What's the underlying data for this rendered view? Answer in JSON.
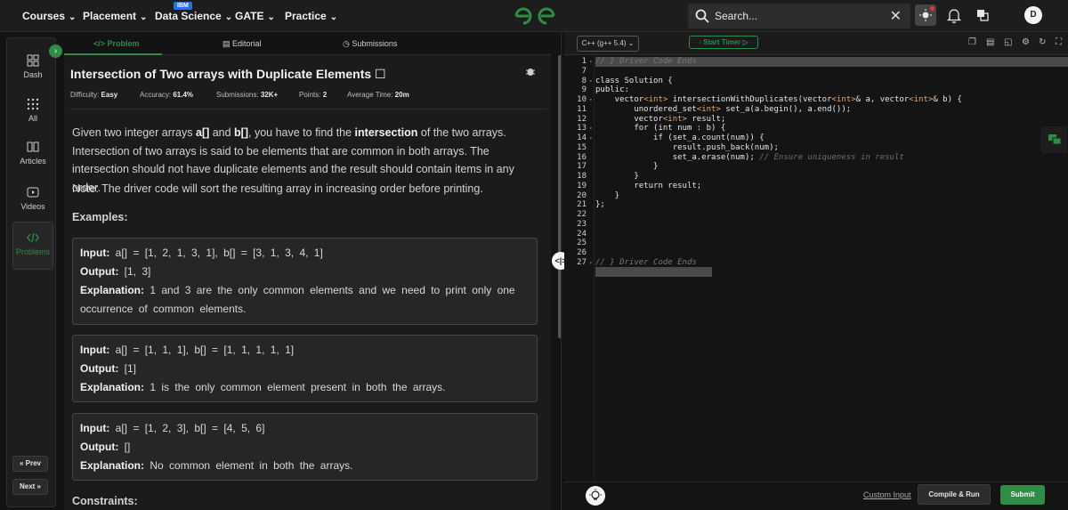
{
  "topnav": {
    "items": [
      {
        "label": "Courses"
      },
      {
        "label": "Placement"
      },
      {
        "label": "Data Science"
      },
      {
        "label": "GATE"
      },
      {
        "label": "Practice"
      }
    ],
    "ibm_badge": "IBM",
    "search_label": "Search...",
    "avatar_initial": "D"
  },
  "sidebar": {
    "items": [
      {
        "label": "Dash",
        "icon": "dashboard-icon"
      },
      {
        "label": "All",
        "icon": "grid-icon"
      },
      {
        "label": "Articles",
        "icon": "book-icon"
      },
      {
        "label": "Videos",
        "icon": "video-icon"
      },
      {
        "label": "Problems",
        "icon": "code-icon",
        "active": true
      }
    ],
    "prev_label": "« Prev",
    "next_label": "Next »"
  },
  "tabs": [
    {
      "label": "</> Problem",
      "active": true
    },
    {
      "label": "Editorial"
    },
    {
      "label": "Submissions"
    }
  ],
  "problem": {
    "title": "Intersection of Two arrays with Duplicate Elements",
    "meta": {
      "difficulty_label": "Difficulty:",
      "difficulty": "Easy",
      "accuracy_label": "Accuracy:",
      "accuracy": "61.4%",
      "submissions_label": "Submissions:",
      "submissions": "32K+",
      "points_label": "Points:",
      "points": "2",
      "time_label": "Average Time:",
      "time": "20m"
    },
    "desc_1": "Given two integer arrays ",
    "desc_a": "a[]",
    "desc_and": " and ",
    "desc_b": "b[]",
    "desc_2": ", you have to find the ",
    "desc_intersection": "intersection",
    "desc_3": " of the two arrays. Intersection of two arrays is said to be elements that are common in both arrays. The intersection should not have duplicate elements and the result should contain items in any order.",
    "note": "Note: The driver code will sort the resulting array in increasing order before printing.",
    "examples_heading": "Examples:",
    "examples": [
      {
        "input_label": "Input:",
        "input": "a[] = [1, 2, 1, 3, 1], b[] = [3, 1, 3, 4, 1]",
        "output_label": "Output:",
        "output": "[1, 3]",
        "explanation_label": "Explanation:",
        "explanation": "1 and 3 are the only common elements and we need to print only one occurrence of common elements."
      },
      {
        "input_label": "Input:",
        "input": "a[] = [1, 1, 1], b[] = [1, 1, 1, 1, 1]",
        "output_label": "Output:",
        "output": "[1]",
        "explanation_label": "Explanation:",
        "explanation": "1 is the only common element present in both the arrays."
      },
      {
        "input_label": "Input:",
        "input": "a[] = [1, 2, 3], b[] = [4, 5, 6]",
        "output_label": "Output:",
        "output": "[]",
        "explanation_label": "Explanation:",
        "explanation": "No common element in both the arrays."
      }
    ],
    "constraints_heading": "Constraints:"
  },
  "editor": {
    "language": "C++ (g++ 5.4)",
    "timer_label": "Start Timer",
    "code_lines": [
      {
        "n": "1",
        "text": "// } Driver Code Ends",
        "hl": true,
        "fold": true
      },
      {
        "n": "7",
        "text": ""
      },
      {
        "n": "8",
        "text": "class Solution {",
        "fold": true
      },
      {
        "n": "9",
        "text": "public:"
      },
      {
        "n": "10",
        "text": "    vector<int> intersectionWithDuplicates(vector<int>& a, vector<int>& b) {",
        "fold": true
      },
      {
        "n": "11",
        "text": "        unordered_set<int> set_a(a.begin(), a.end());"
      },
      {
        "n": "12",
        "text": "        vector<int> result;"
      },
      {
        "n": "13",
        "text": "        for (int num : b) {",
        "fold": true
      },
      {
        "n": "14",
        "text": "            if (set_a.count(num)) {",
        "fold": true
      },
      {
        "n": "15",
        "text": "                result.push_back(num);"
      },
      {
        "n": "16",
        "text": "                set_a.erase(num); // Ensure uniqueness in result"
      },
      {
        "n": "17",
        "text": "            }"
      },
      {
        "n": "18",
        "text": "        }"
      },
      {
        "n": "19",
        "text": "        return result;"
      },
      {
        "n": "20",
        "text": "    }"
      },
      {
        "n": "21",
        "text": "};"
      },
      {
        "n": "22",
        "text": ""
      },
      {
        "n": "23",
        "text": ""
      },
      {
        "n": "24",
        "text": ""
      },
      {
        "n": "25",
        "text": ""
      },
      {
        "n": "26",
        "text": ""
      },
      {
        "n": "27",
        "text": "// } Driver Code Ends",
        "hl": true,
        "fold": true
      }
    ],
    "custom_input_label": "Custom Input",
    "compile_label": "Compile & Run",
    "submit_label": "Submit"
  },
  "colors": {
    "accent": "#2f8d46",
    "background": "#131313",
    "panel": "#1b1b1b"
  }
}
